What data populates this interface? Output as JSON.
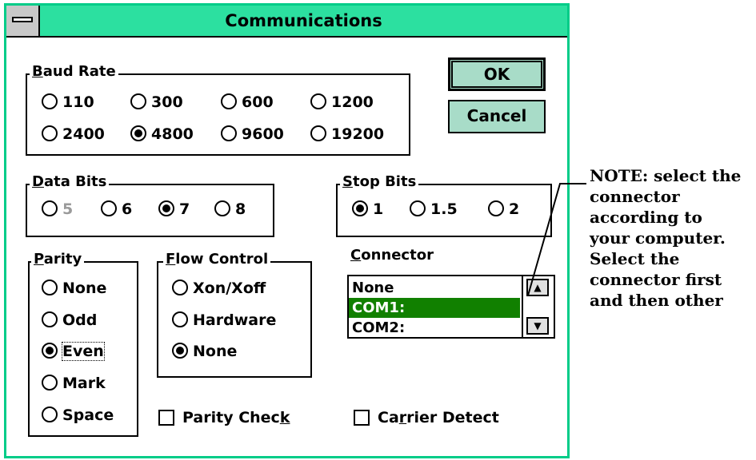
{
  "window": {
    "title": "Communications"
  },
  "buttons": {
    "ok": "OK",
    "cancel": "Cancel"
  },
  "baud": {
    "label_u": "B",
    "label_rest": "aud Rate",
    "options": [
      "110",
      "300",
      "600",
      "1200",
      "2400",
      "4800",
      "9600",
      "19200"
    ],
    "selected": "4800"
  },
  "data_bits": {
    "label_u": "D",
    "label_rest": "ata Bits",
    "options": [
      "5",
      "6",
      "7",
      "8"
    ],
    "selected": "7",
    "disabled": "5"
  },
  "stop_bits": {
    "label_u": "S",
    "label_rest": "top Bits",
    "options": [
      "1",
      "1.5",
      "2"
    ],
    "selected": "1"
  },
  "parity": {
    "label_u": "P",
    "label_rest": "arity",
    "options": [
      "None",
      "Odd",
      "Even",
      "Mark",
      "Space"
    ],
    "selected": "Even"
  },
  "flow": {
    "label_u": "F",
    "label_rest": "low Control",
    "options": [
      "Xon/Xoff",
      "Hardware",
      "None"
    ],
    "selected": "None"
  },
  "connector": {
    "label_u": "C",
    "label_rest": "onnector",
    "items": [
      "None",
      "COM1:",
      "COM2:"
    ],
    "selected": "COM1:"
  },
  "checks": {
    "parity_check_a": "Parity Chec",
    "parity_check_u": "k",
    "carrier_a": "Ca",
    "carrier_u": "r",
    "carrier_b": "rier Detect"
  },
  "note": {
    "lines": [
      "NOTE: select the",
      "connector",
      "according to",
      "your computer.",
      "Select the",
      "connector first",
      "and then other"
    ]
  },
  "colors": {
    "titlebar": "#2ce0a0",
    "button": "#a8dcc8",
    "selection": "#118000",
    "frame": "#00cc88"
  }
}
